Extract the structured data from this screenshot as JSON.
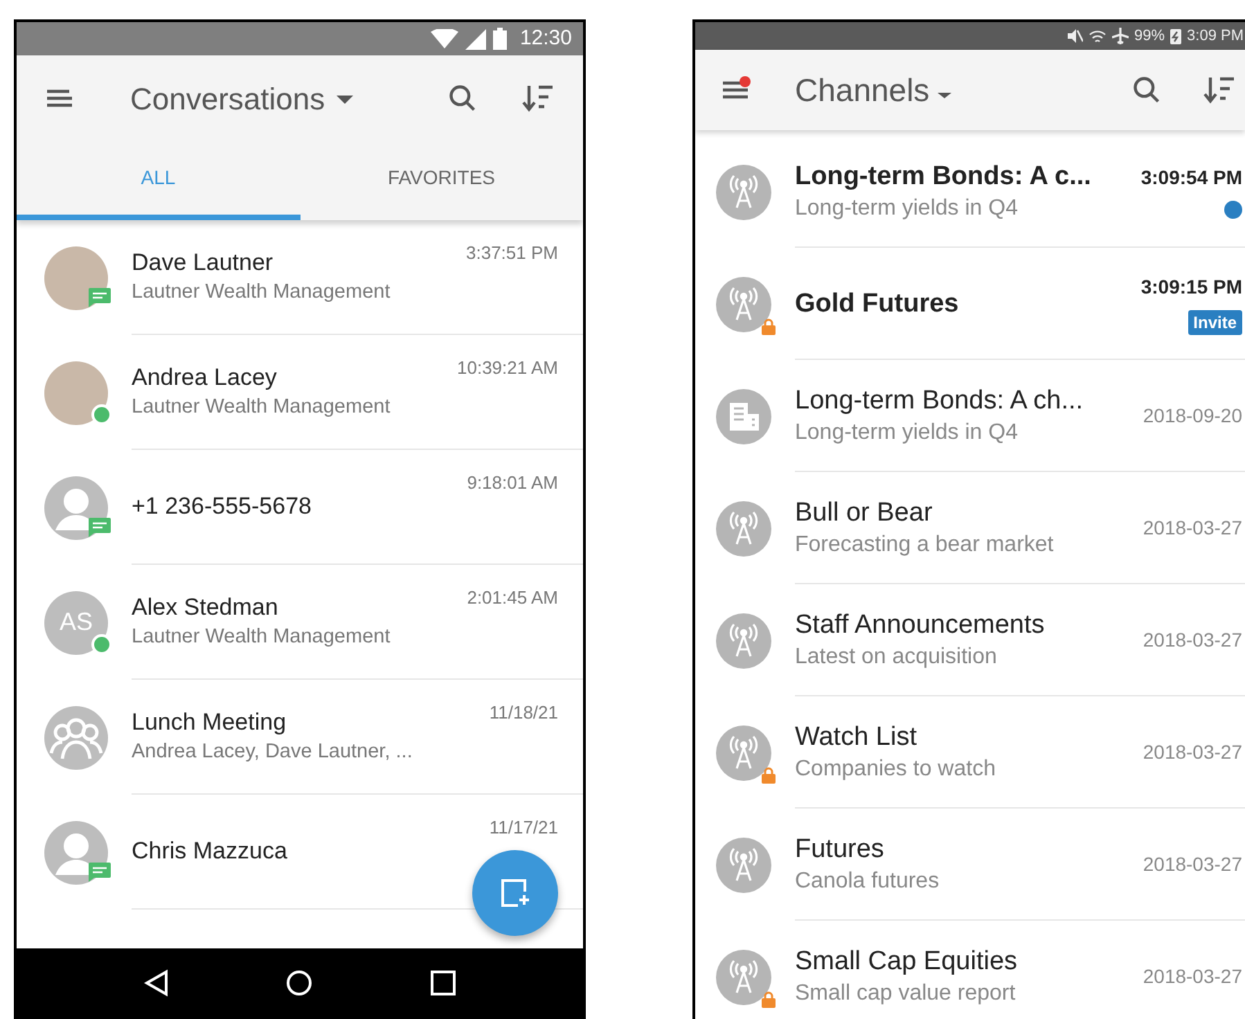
{
  "conversations_screen": {
    "status_bar": {
      "time": "12:30"
    },
    "toolbar": {
      "title": "Conversations"
    },
    "tabs": [
      {
        "label": "ALL",
        "selected": true
      },
      {
        "label": "FAVORITES",
        "selected": false
      }
    ],
    "items": [
      {
        "avatar": {
          "kind": "photo"
        },
        "badge": {
          "kind": "message"
        },
        "name": "Dave Lautner",
        "subtitle": "Lautner Wealth Management",
        "time": "3:37:51 PM"
      },
      {
        "avatar": {
          "kind": "photo"
        },
        "badge": {
          "kind": "online"
        },
        "name": "Andrea Lacey",
        "subtitle": "Lautner Wealth Management",
        "time": "10:39:21 AM"
      },
      {
        "avatar": {
          "kind": "person"
        },
        "badge": {
          "kind": "message"
        },
        "name": "+1 236-555-5678",
        "time": "9:18:01 AM"
      },
      {
        "avatar": {
          "kind": "initials",
          "initials": "AS"
        },
        "badge": {
          "kind": "online"
        },
        "name": "Alex Stedman",
        "subtitle": "Lautner Wealth Management",
        "time": "2:01:45 AM"
      },
      {
        "avatar": {
          "kind": "group"
        },
        "name": "Lunch Meeting",
        "subtitle": "Andrea Lacey, Dave Lautner, ...",
        "time": "11/18/21"
      },
      {
        "avatar": {
          "kind": "person"
        },
        "badge": {
          "kind": "message"
        },
        "name": "Chris Mazzuca",
        "time": "11/17/21"
      }
    ]
  },
  "channels_screen": {
    "status_bar": {
      "battery": "99%",
      "time": "3:09 PM"
    },
    "toolbar": {
      "title": "Channels",
      "menu_notification": true
    },
    "items": [
      {
        "icon": {
          "kind": "broadcast"
        },
        "locked": false,
        "unread": true,
        "name": "Long-term Bonds: A c...",
        "subtitle": "Long-term yields in Q4",
        "time": "3:09:54 PM",
        "unread_dot": true
      },
      {
        "icon": {
          "kind": "broadcast"
        },
        "locked": true,
        "unread": true,
        "name": "Gold Futures",
        "time": "3:09:15 PM",
        "badge": "Invite"
      },
      {
        "icon": {
          "kind": "building"
        },
        "locked": false,
        "unread": false,
        "name": "Long-term Bonds: A ch...",
        "subtitle": "Long-term yields in Q4",
        "time": "2018-09-20"
      },
      {
        "icon": {
          "kind": "broadcast"
        },
        "locked": false,
        "unread": false,
        "name": "Bull or Bear",
        "subtitle": "Forecasting a bear market",
        "time": "2018-03-27"
      },
      {
        "icon": {
          "kind": "broadcast"
        },
        "locked": false,
        "unread": false,
        "name": "Staff Announcements",
        "subtitle": "Latest on acquisition",
        "time": "2018-03-27"
      },
      {
        "icon": {
          "kind": "broadcast"
        },
        "locked": true,
        "unread": false,
        "name": "Watch List",
        "subtitle": "Companies to watch",
        "time": "2018-03-27"
      },
      {
        "icon": {
          "kind": "broadcast"
        },
        "locked": false,
        "unread": false,
        "name": "Futures",
        "subtitle": "Canola futures",
        "time": "2018-03-27"
      },
      {
        "icon": {
          "kind": "broadcast"
        },
        "locked": true,
        "unread": false,
        "name": "Small Cap Equities",
        "subtitle": "Small cap value report",
        "time": "2018-03-27"
      }
    ]
  }
}
